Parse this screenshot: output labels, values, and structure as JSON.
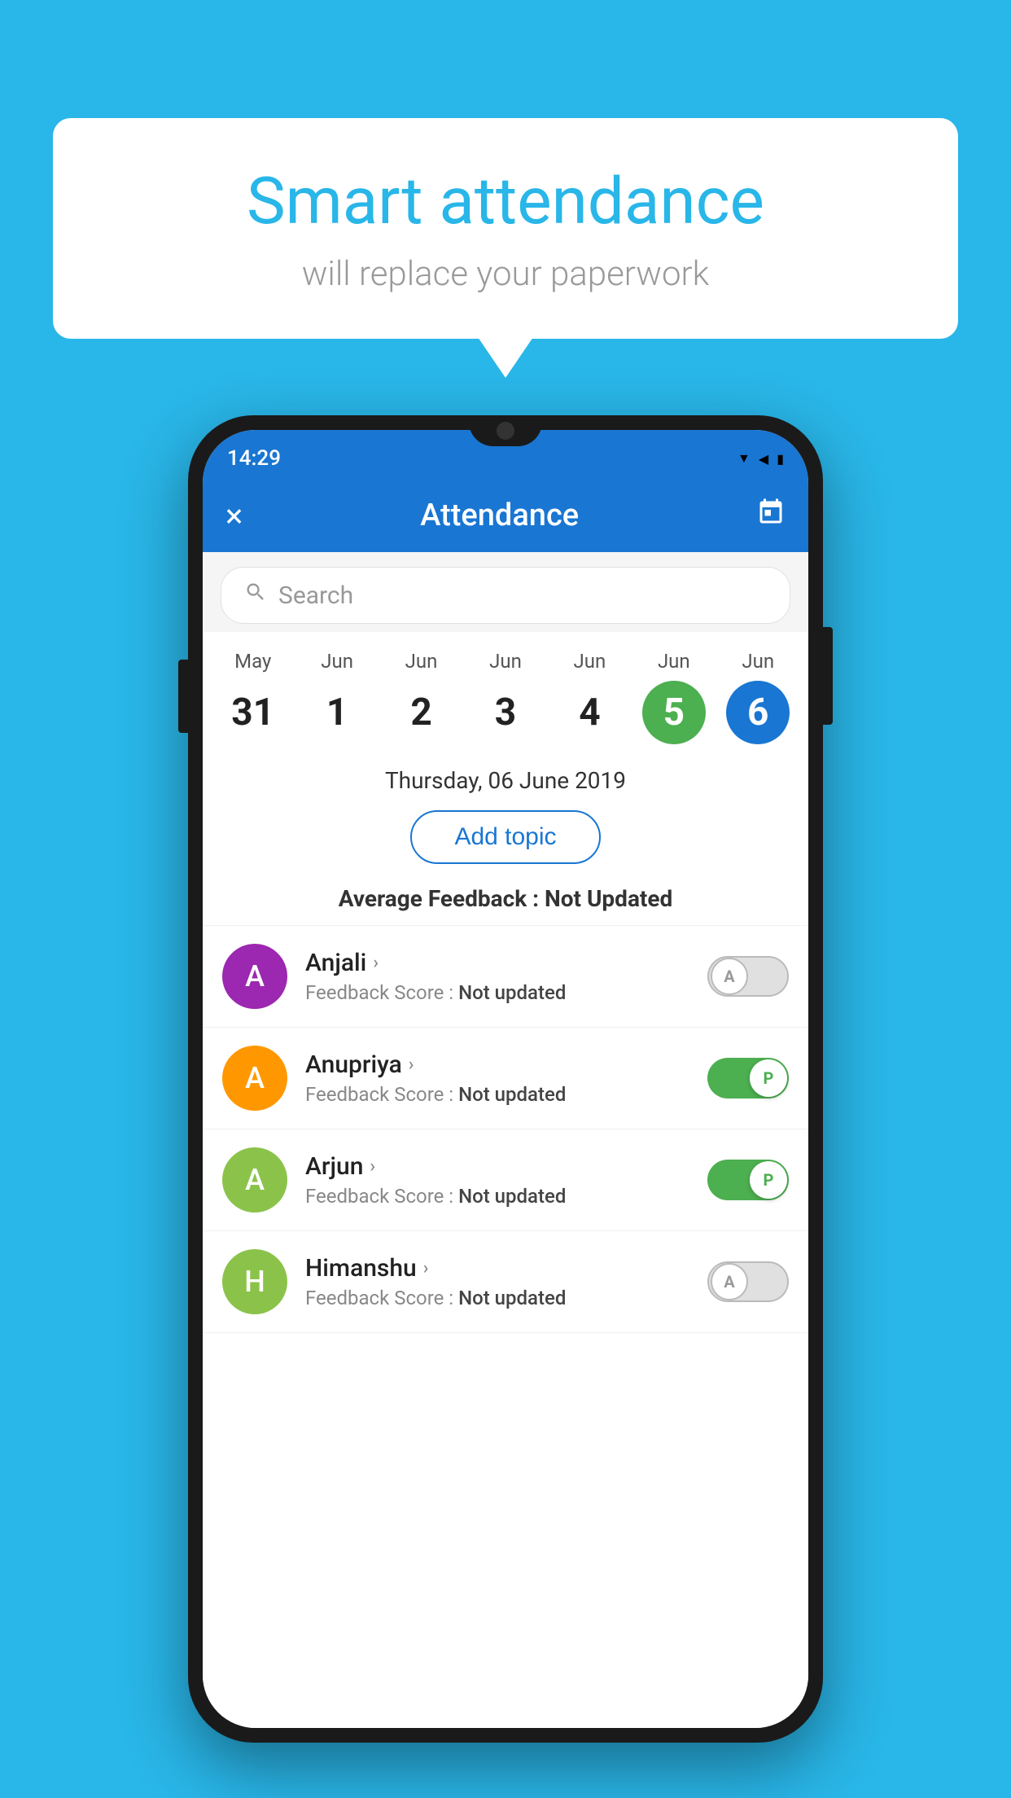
{
  "background_color": "#29b6e8",
  "bubble": {
    "title": "Smart attendance",
    "subtitle": "will replace your paperwork"
  },
  "phone": {
    "status_bar": {
      "time": "14:29",
      "icons": [
        "wifi",
        "signal",
        "battery"
      ]
    },
    "header": {
      "title": "Attendance",
      "close_label": "×",
      "calendar_icon": "📅"
    },
    "search": {
      "placeholder": "Search"
    },
    "calendar": {
      "days": [
        {
          "month": "May",
          "date": "31",
          "state": "normal"
        },
        {
          "month": "Jun",
          "date": "1",
          "state": "normal"
        },
        {
          "month": "Jun",
          "date": "2",
          "state": "normal"
        },
        {
          "month": "Jun",
          "date": "3",
          "state": "normal"
        },
        {
          "month": "Jun",
          "date": "4",
          "state": "normal"
        },
        {
          "month": "Jun",
          "date": "5",
          "state": "today"
        },
        {
          "month": "Jun",
          "date": "6",
          "state": "selected"
        }
      ]
    },
    "selected_date": "Thursday, 06 June 2019",
    "add_topic_label": "Add topic",
    "avg_feedback_label": "Average Feedback :",
    "avg_feedback_value": "Not Updated",
    "students": [
      {
        "name": "Anjali",
        "feedback_label": "Feedback Score :",
        "feedback_value": "Not updated",
        "avatar_letter": "A",
        "avatar_color": "#9c27b0",
        "attendance": "absent",
        "toggle_label": "A"
      },
      {
        "name": "Anupriya",
        "feedback_label": "Feedback Score :",
        "feedback_value": "Not updated",
        "avatar_letter": "A",
        "avatar_color": "#ff9800",
        "attendance": "present",
        "toggle_label": "P"
      },
      {
        "name": "Arjun",
        "feedback_label": "Feedback Score :",
        "feedback_value": "Not updated",
        "avatar_letter": "A",
        "avatar_color": "#8bc34a",
        "attendance": "present",
        "toggle_label": "P"
      },
      {
        "name": "Himanshu",
        "feedback_label": "Feedback Score :",
        "feedback_value": "Not updated",
        "avatar_letter": "H",
        "avatar_color": "#8bc34a",
        "attendance": "absent",
        "toggle_label": "A"
      }
    ]
  }
}
